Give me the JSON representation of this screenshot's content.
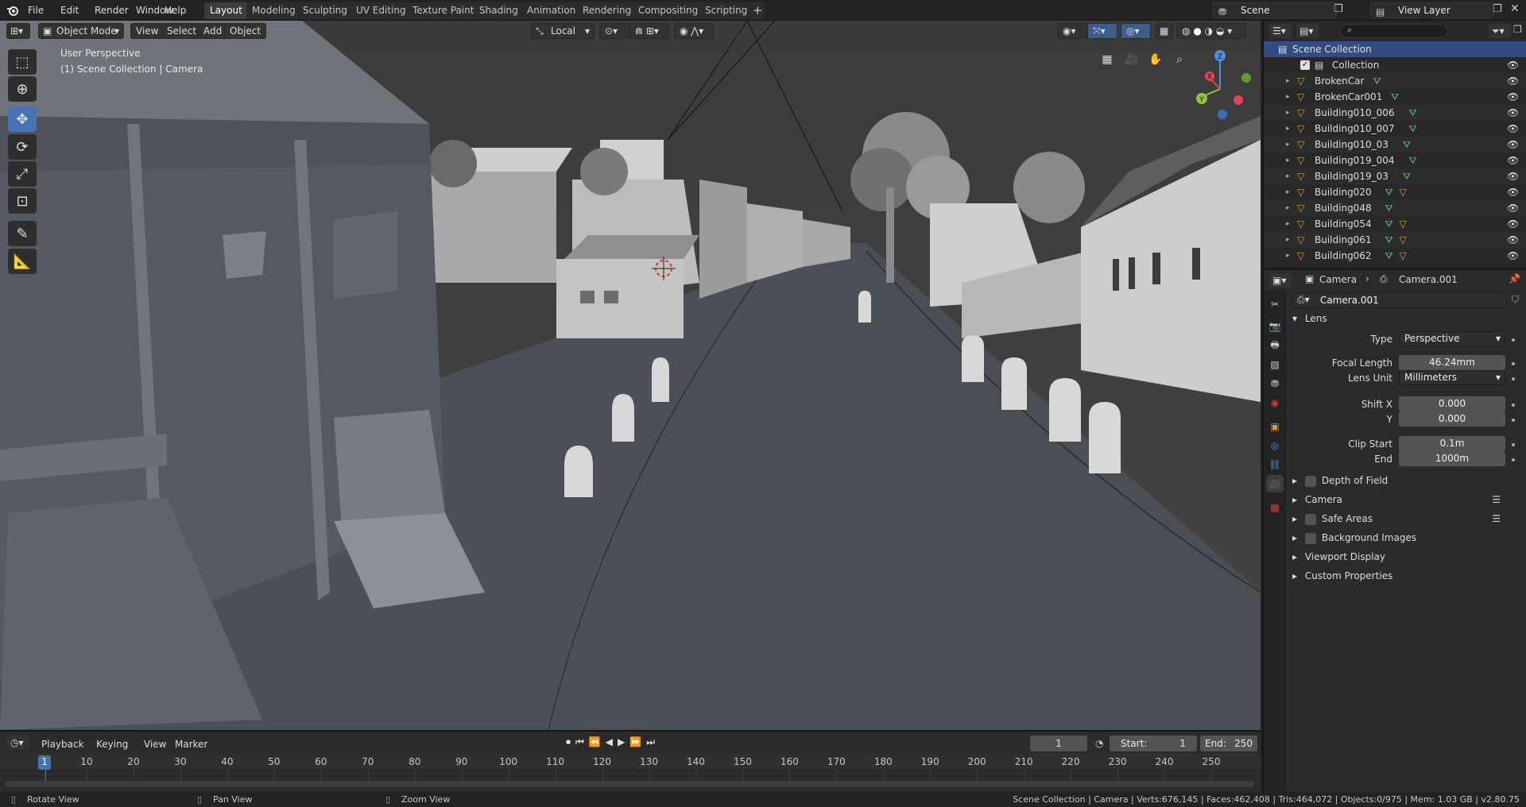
{
  "topbar": {
    "menus": [
      "File",
      "Edit",
      "Render",
      "Window",
      "Help"
    ],
    "workspaces": [
      "Layout",
      "Modeling",
      "Sculpting",
      "UV Editing",
      "Texture Paint",
      "Shading",
      "Animation",
      "Rendering",
      "Compositing",
      "Scripting"
    ],
    "add_tab": "+",
    "scene": "Scene",
    "view_layer": "View Layer"
  },
  "viewport": {
    "mode": "Object Mode",
    "menus": [
      "View",
      "Select",
      "Add",
      "Object"
    ],
    "orientation": "Local",
    "overlay_line1": "User Perspective",
    "overlay_line2": "(1) Scene Collection | Camera",
    "gizmo_axes": [
      "X",
      "Y",
      "Z"
    ]
  },
  "outliner": {
    "search_placeholder": "",
    "root": "Scene Collection",
    "collection": "Collection",
    "objects": [
      "BrokenCar",
      "BrokenCar001",
      "Building010_006",
      "Building010_007",
      "Building010_03",
      "Building019_004",
      "Building019_03",
      "Building020",
      "Building048",
      "Building054",
      "Building061",
      "Building062"
    ]
  },
  "properties": {
    "breadcrumb_object": "Camera",
    "breadcrumb_data": "Camera.001",
    "datablock": "Camera.001",
    "lens_panel": "Lens",
    "type_label": "Type",
    "type_value": "Perspective",
    "focal_length_label": "Focal Length",
    "focal_length": "46.24mm",
    "lens_unit_label": "Lens Unit",
    "lens_unit": "Millimeters",
    "shift_x_label": "Shift X",
    "shift_x": "0.000",
    "shift_y_label": "Y",
    "shift_y": "0.000",
    "clip_start_label": "Clip Start",
    "clip_start": "0.1m",
    "clip_end_label": "End",
    "clip_end": "1000m",
    "panels": [
      "Depth of Field",
      "Camera",
      "Safe Areas",
      "Background Images",
      "Viewport Display",
      "Custom Properties"
    ]
  },
  "timeline": {
    "menus": [
      "Playback",
      "Keying",
      "View",
      "Marker"
    ],
    "current_frame": "1",
    "start_label": "Start:",
    "start": "1",
    "end_label": "End:",
    "end": "250",
    "ticks": [
      "1",
      "10",
      "20",
      "30",
      "40",
      "50",
      "60",
      "70",
      "80",
      "90",
      "100",
      "110",
      "120",
      "130",
      "140",
      "150",
      "160",
      "170",
      "180",
      "190",
      "200",
      "210",
      "220",
      "230",
      "240",
      "250"
    ]
  },
  "statusbar": {
    "rotate": "Rotate View",
    "pan": "Pan View",
    "zoom": "Zoom View",
    "stats": "Scene Collection | Camera | Verts:676,145 | Faces:462,408 | Tris:464,072 | Objects:0/975 | Mem: 1.03 GB | v2.80.75"
  },
  "colors": {
    "accent": "#4772b3",
    "object_icon": "#e89a3c",
    "mesh_icon": "#59c28e",
    "axis_x": "#e0455a",
    "axis_y": "#8bc73f",
    "axis_z": "#4f8fe8"
  }
}
